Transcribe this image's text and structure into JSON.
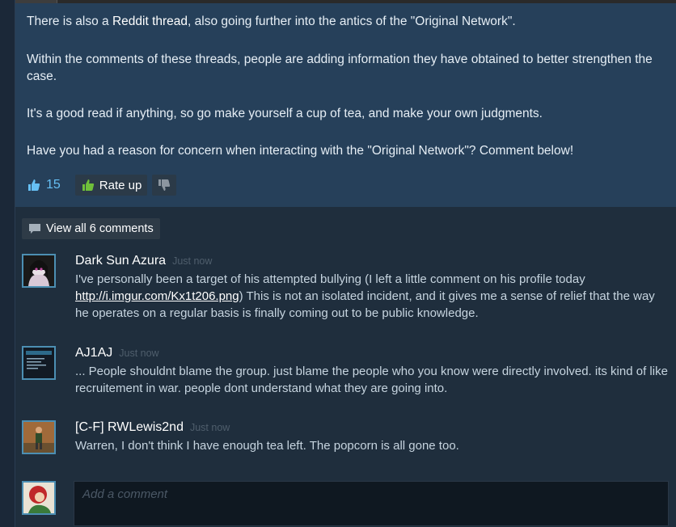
{
  "post": {
    "para1_before": "There is also a ",
    "para1_link": "Reddit thread",
    "para1_after": ", also going further into the antics of the \"Original Network\".",
    "para2": "Within the comments of these threads, people are adding information they have obtained to better strengthen the case.",
    "para3": "It's a good read if anything, so go make yourself a cup of tea, and make your own judgments.",
    "para4": "Have you had a reason for concern when interacting with the \"Original Network\"? Comment below!",
    "vote_count": "15",
    "rate_up_label": "Rate up"
  },
  "comments": {
    "view_all_label": "View all 6 comments",
    "items": [
      {
        "author": "Dark Sun Azura",
        "time": "Just now",
        "text_before": "I've personally been a target of his attempted bullying (I left a little comment on his profile today ",
        "link": "http://i.imgur.com/Kx1t206.png",
        "text_after": ") This is not an isolated incident, and it gives me a sense of relief that the way he operates on a regular basis is finally coming out to be public knowledge."
      },
      {
        "author": "AJ1AJ",
        "time": "Just now",
        "text": "... People shouldnt blame the group. just blame the people who you know were directly involved. its kind of like recruitement in war. people dont understand what they are going into."
      },
      {
        "author": "[C-F] RWLewis2nd",
        "time": "Just now",
        "text": "Warren, I don't think I have enough tea left. The popcorn is all gone too."
      }
    ],
    "add_placeholder": "Add a comment"
  },
  "colors": {
    "accent": "#66c0f4",
    "post_bg": "#26405a",
    "comments_bg": "#1f2e3d",
    "button_bg": "#2b3a48",
    "thumb_green": "#6fbf3a"
  },
  "icons": [
    "thumbs-up-icon",
    "thumbs-down-icon",
    "speech-bubble-icon"
  ]
}
